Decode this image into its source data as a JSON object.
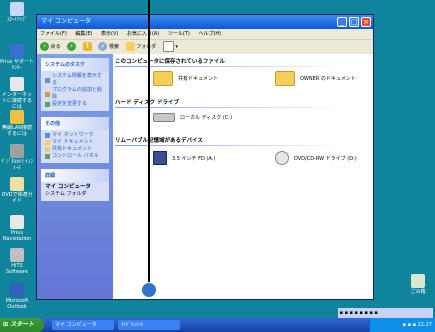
{
  "desktop": {
    "icons": [
      {
        "label": "ｽﾀｰﾄｱｯﾌﾟ",
        "icon": "startup-icon",
        "color": "#c8d8f8"
      },
      {
        "label": "Prius サポートｾﾝﾀｰ",
        "icon": "support-icon",
        "color": "#3a6fd0"
      },
      {
        "label": "インターネットに接続するには",
        "icon": "internet-icon",
        "color": "#e8e8e8"
      },
      {
        "label": "無線LAN接続するには",
        "icon": "wireless-icon",
        "color": "#f0c040"
      },
      {
        "label": "ﾃﾞｼﾞﾀﾙｶﾒﾗ ｲﾝﾌｫｰﾙ",
        "icon": "camera-icon",
        "color": "#a0a0a0"
      },
      {
        "label": "DVDで快適ガイド",
        "icon": "dvd-guide-icon",
        "color": "#f0e0a0"
      },
      {
        "label": "Prius Navistation",
        "icon": "navistation-icon",
        "color": "#e8e8e8"
      },
      {
        "label": "HITS Software",
        "icon": "hits-icon",
        "color": "#c0c0c0"
      },
      {
        "label": "Microsoft Outlook",
        "icon": "outlook-icon",
        "color": "#3060c0"
      }
    ],
    "recycle_bin": {
      "label": "ごみ箱",
      "icon": "recycle-bin-icon"
    }
  },
  "window": {
    "title": "マイ コンピュータ",
    "menu": [
      "ファイル(F)",
      "編集(E)",
      "表示(V)",
      "お気に入り(A)",
      "ツール(T)",
      "ヘルプ(H)"
    ],
    "toolbar": {
      "back": "戻る",
      "search": "検索",
      "folders": "フォルダ"
    },
    "taskpane": {
      "system_tasks": {
        "title": "システムのタスク",
        "items": [
          "システム情報を表示する",
          "プログラムの追加と削除",
          "設定を変更する"
        ]
      },
      "other_places": {
        "title": "その他",
        "items": [
          "マイ ネットワーク",
          "マイ ドキュメント",
          "共有ドキュメント",
          "コントロール パネル"
        ]
      },
      "details": {
        "title": "詳細",
        "name": "マイ コンピュータ",
        "sub": "システム フォルダ"
      }
    },
    "sections": {
      "shared": {
        "title": "このコンピュータに保存されているファイル",
        "items": [
          "共有ドキュメント",
          "OWNER のドキュメント"
        ]
      },
      "hdd": {
        "title": "ハード ディスク ドライブ",
        "items": [
          "ローカル ディスク (C:)"
        ]
      },
      "removable": {
        "title": "リムーバブル記憶域があるデバイス",
        "items": [
          "3.5 インチ FD (A:)",
          "DVD/CD-RW ドライブ (D:)"
        ]
      }
    }
  },
  "taskbar": {
    "start": "スタート",
    "tasks": [
      "マイ コンピュータ",
      "ﾏｲﾄﾞｷｭﾒﾝﾄ"
    ],
    "clock": "22:27"
  },
  "colors": {
    "desktop": "#10849a",
    "taskbar": "#1941a5",
    "cursor_dot": "#2e74cc"
  }
}
